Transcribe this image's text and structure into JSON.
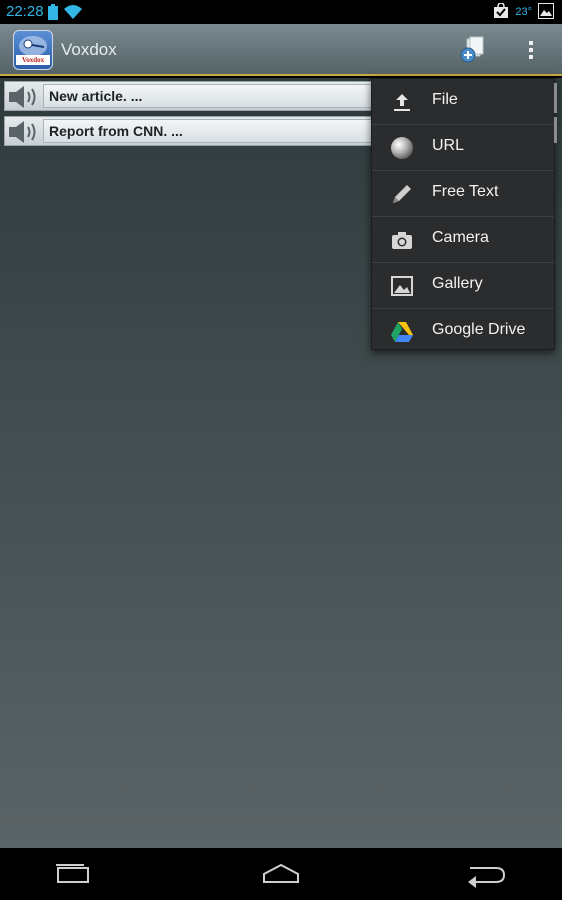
{
  "status_bar": {
    "time": "22:28",
    "temperature": "23°",
    "icons": [
      "battery-icon",
      "wifi-icon",
      "shopping-bag-check-icon",
      "weather-icon",
      "image-icon"
    ]
  },
  "action_bar": {
    "app_title": "Voxdox",
    "logo_text": "Voxdox",
    "actions": [
      "add-document-icon",
      "overflow-menu-icon"
    ]
  },
  "list": {
    "items": [
      {
        "label": "New article.  ...",
        "icon": "speaker-icon"
      },
      {
        "label": "Report from CNN. ...",
        "icon": "speaker-icon"
      }
    ]
  },
  "menu": {
    "items": [
      {
        "label": "File",
        "icon": "upload-icon"
      },
      {
        "label": "URL",
        "icon": "globe-icon"
      },
      {
        "label": "Free Text",
        "icon": "pencil-icon"
      },
      {
        "label": "Camera",
        "icon": "camera-icon"
      },
      {
        "label": "Gallery",
        "icon": "picture-icon"
      },
      {
        "label": "Google Drive",
        "icon": "google-drive-icon"
      }
    ]
  },
  "nav_bar": {
    "buttons": [
      "recent-apps-icon",
      "home-icon",
      "back-icon"
    ]
  },
  "colors": {
    "accent": "#33b5e5",
    "action_bar_divider": "#c9a84a",
    "menu_bg": "#2b2c2e"
  }
}
